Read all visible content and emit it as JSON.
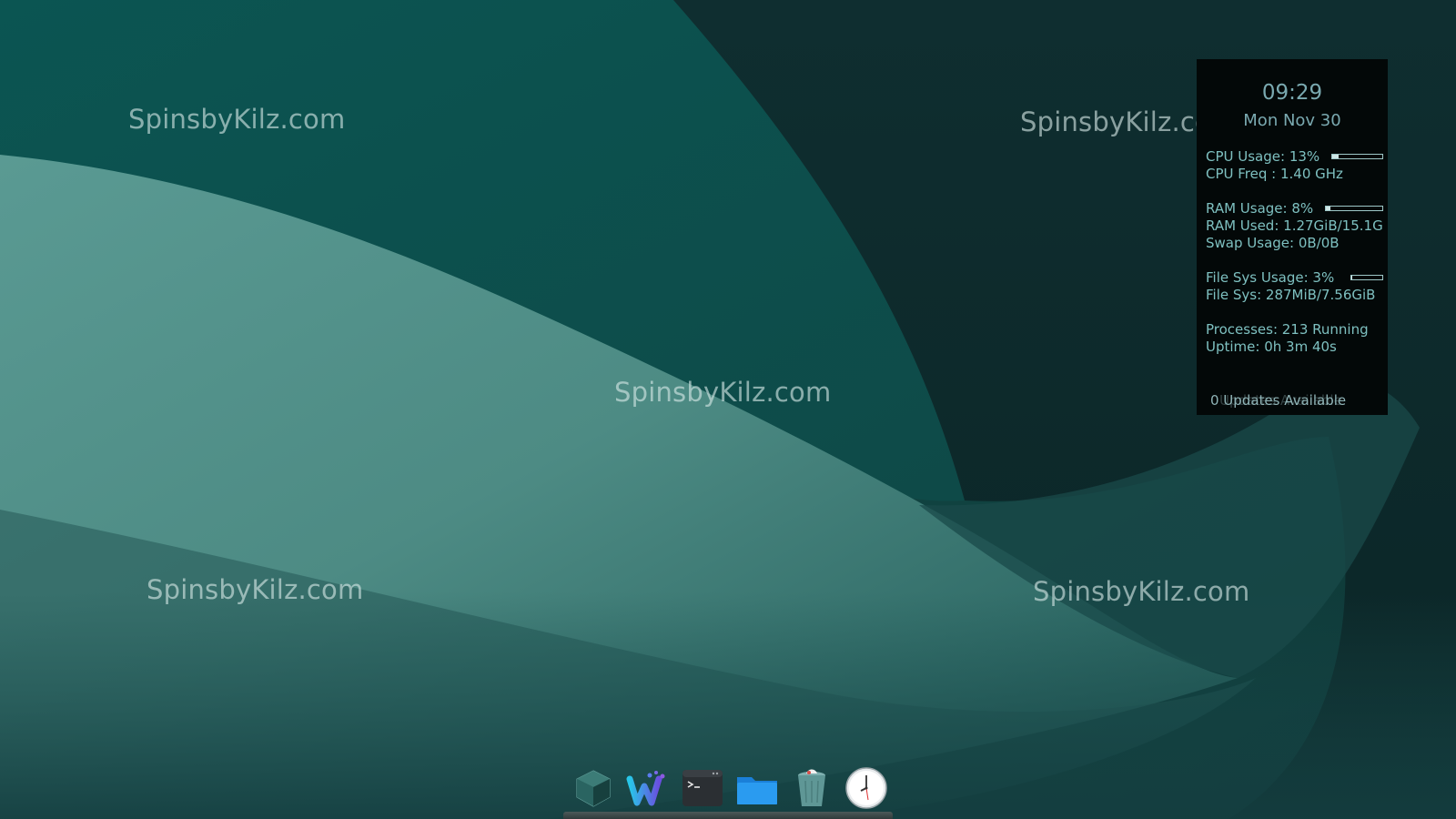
{
  "watermarks": [
    "SpinsbyKilz.com",
    "SpinsbyKilz.com",
    "SpinsbyKilz.com",
    "SpinsbyKilz.com",
    "SpinsbyKilz.com"
  ],
  "conky": {
    "time": "09:29",
    "date": "Mon Nov 30",
    "cpu_usage": "CPU Usage: 13%",
    "cpu_usage_value": 0.13,
    "cpu_freq": "CPU Freq : 1.40 GHz",
    "ram_usage": "RAM Usage: 8%",
    "ram_usage_value": 0.08,
    "ram_used": "RAM Used: 1.27GiB/15.1G",
    "swap_usage": "Swap Usage: 0B/0B",
    "fs_usage": "File Sys Usage:  3%",
    "fs_usage_value": 0.03,
    "fs_size": "File Sys: 287MiB/7.56GiB",
    "processes": "Processes: 213   Running",
    "uptime": "Uptime: 0h 3m 40s",
    "updates": "0 Updates Available",
    "updates_ghost": "Updates Available"
  },
  "dock": {
    "items": [
      {
        "icon": "cube-icon"
      },
      {
        "icon": "windsurf-w-icon"
      },
      {
        "icon": "terminal-icon"
      },
      {
        "icon": "folder-icon"
      },
      {
        "icon": "trash-icon"
      },
      {
        "icon": "clock-icon"
      }
    ]
  },
  "colors": {
    "wallpaper_dark": "#0f3f3e",
    "wallpaper_light": "#4f8c86",
    "conky_bg": "#030808",
    "conky_text": "#7ec0c0"
  }
}
